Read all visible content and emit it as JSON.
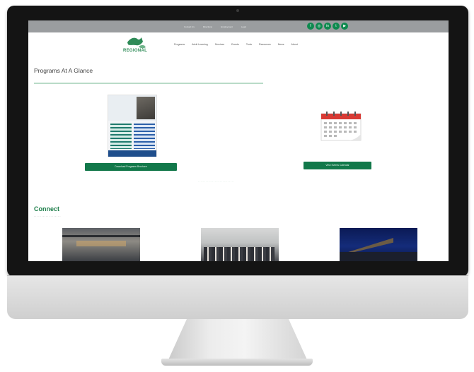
{
  "top_bar": {
    "links": [
      "Contact Us",
      "Directions",
      "Employment",
      "Login"
    ],
    "social_icons": [
      "facebook-icon",
      "instagram-icon",
      "linkedin-icon",
      "twitter-icon",
      "youtube-icon"
    ]
  },
  "header": {
    "logo_text": "REGIONAL",
    "nav": [
      "Programs",
      "Adult Learning",
      "Services",
      "Events",
      "Tools",
      "Resources",
      "News",
      "About"
    ]
  },
  "main": {
    "section_title": "Programs At A Glance",
    "brochure_button": "Download Programs Brochure",
    "calendar_button": "View Events Calendar",
    "connect_title": "Connect",
    "colors": {
      "accent": "#12784a",
      "top_bar": "#9a9d9f"
    }
  }
}
